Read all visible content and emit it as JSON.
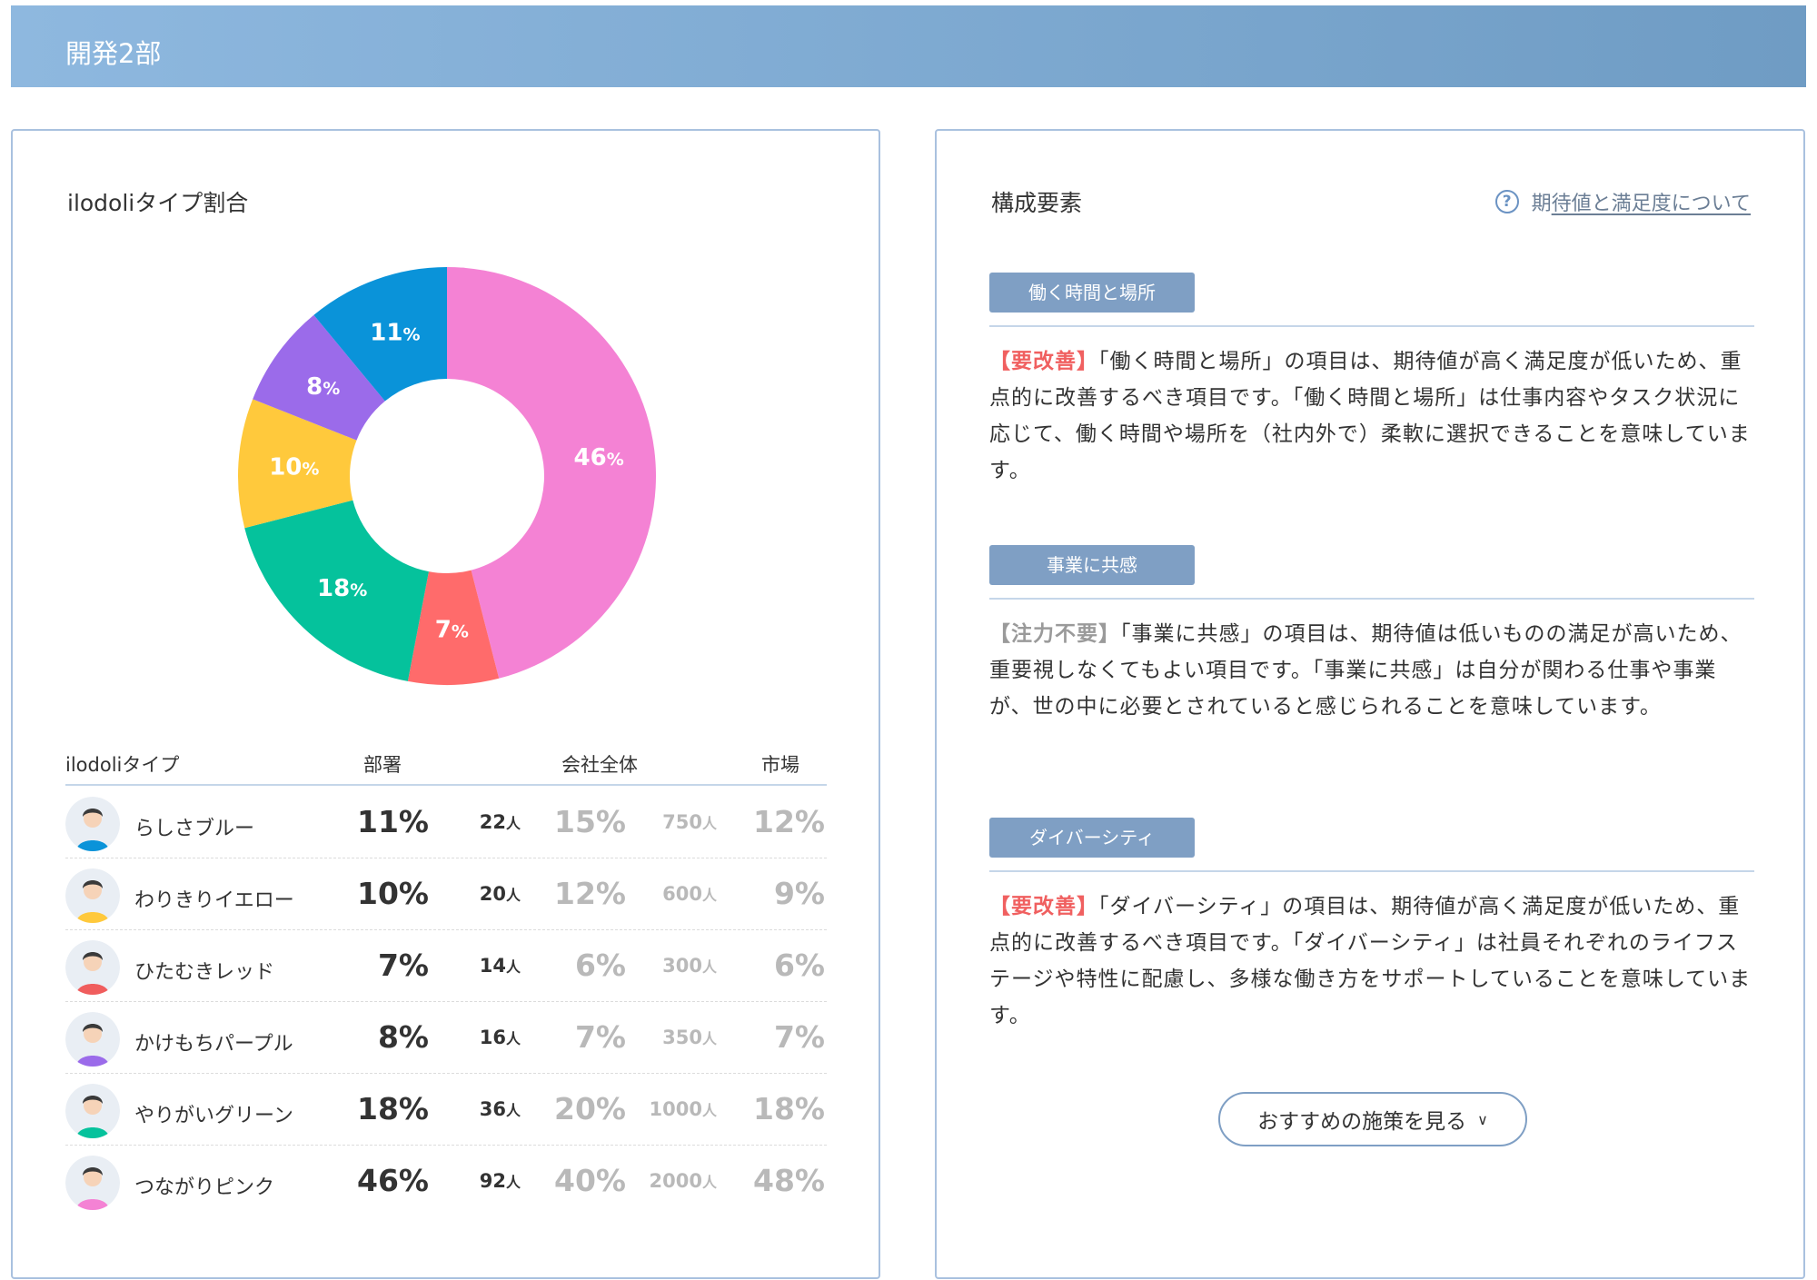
{
  "header": {
    "title": "開発2部"
  },
  "left": {
    "title": "ilodoliタイプ割合",
    "table_headers": {
      "type": "ilodoliタイプ",
      "dept": "部署",
      "company": "会社全体",
      "market": "市場"
    },
    "unit": "人",
    "rows": [
      {
        "name": "らしさブルー",
        "dept_pct": "11%",
        "dept_cnt": "22",
        "co_pct": "15%",
        "co_cnt": "750",
        "mk_pct": "12%",
        "avatar_color": "#0a93d9"
      },
      {
        "name": "わりきりイエロー",
        "dept_pct": "10%",
        "dept_cnt": "20",
        "co_pct": "12%",
        "co_cnt": "600",
        "mk_pct": "9%",
        "avatar_color": "#ffc93c"
      },
      {
        "name": "ひたむきレッド",
        "dept_pct": "7%",
        "dept_cnt": "14",
        "co_pct": "6%",
        "co_cnt": "300",
        "mk_pct": "6%",
        "avatar_color": "#f05d5d"
      },
      {
        "name": "かけもちパープル",
        "dept_pct": "8%",
        "dept_cnt": "16",
        "co_pct": "7%",
        "co_cnt": "350",
        "mk_pct": "7%",
        "avatar_color": "#9b6bea"
      },
      {
        "name": "やりがいグリーン",
        "dept_pct": "18%",
        "dept_cnt": "36",
        "co_pct": "20%",
        "co_cnt": "1000",
        "mk_pct": "18%",
        "avatar_color": "#05c29c"
      },
      {
        "name": "つながりピンク",
        "dept_pct": "46%",
        "dept_cnt": "92",
        "co_pct": "40%",
        "co_cnt": "2000",
        "mk_pct": "48%",
        "avatar_color": "#f482d4"
      }
    ]
  },
  "chart_data": {
    "type": "pie",
    "donut": true,
    "slices": [
      {
        "label": "つながりピンク",
        "value": 46,
        "display": "46",
        "color": "#f482d4"
      },
      {
        "label": "ひたむきレッド",
        "value": 7,
        "display": "7",
        "color": "#ff6b6b"
      },
      {
        "label": "やりがいグリーン",
        "value": 18,
        "display": "18",
        "color": "#05c29c"
      },
      {
        "label": "わりきりイエロー",
        "value": 10,
        "display": "10",
        "color": "#ffc93c"
      },
      {
        "label": "かけもちパープル",
        "value": 8,
        "display": "8",
        "color": "#9b6bea"
      },
      {
        "label": "らしさブルー",
        "value": 11,
        "display": "11",
        "color": "#0a93d9"
      }
    ],
    "pct_suffix": "%"
  },
  "right": {
    "title": "構成要素",
    "help_prefix": "期",
    "help_link": "待値と満足度について",
    "sections": [
      {
        "tag": "働く時間と場所",
        "badge": "【要改善】",
        "text": "「働く時間と場所」の項目は、期待値が高く満足度が低いため、重点的に改善するべき項目です。「働く時間と場所」は仕事内容やタスク状況に応じて、働く時間や場所を（社内外で）柔軟に選択できることを意味しています。"
      },
      {
        "tag": "事業に共感",
        "badge": "【注力不要】",
        "text": "「事業に共感」の項目は、期待値は低いものの満足が高いため、重要視しなくてもよい項目です。「事業に共感」は自分が関わる仕事や事業が、世の中に必要とされていると感じられることを意味しています。"
      },
      {
        "tag": "ダイバーシティ",
        "badge": "【要改善】",
        "text": "「ダイバーシティ」の項目は、期待値が高く満足度が低いため、重点的に改善するべき項目です。「ダイバーシティ」は社員それぞれのライフステージや特性に配慮し、多様な働き方をサポートしていることを意味しています。"
      }
    ],
    "more_button": "おすすめの施策を見る"
  }
}
